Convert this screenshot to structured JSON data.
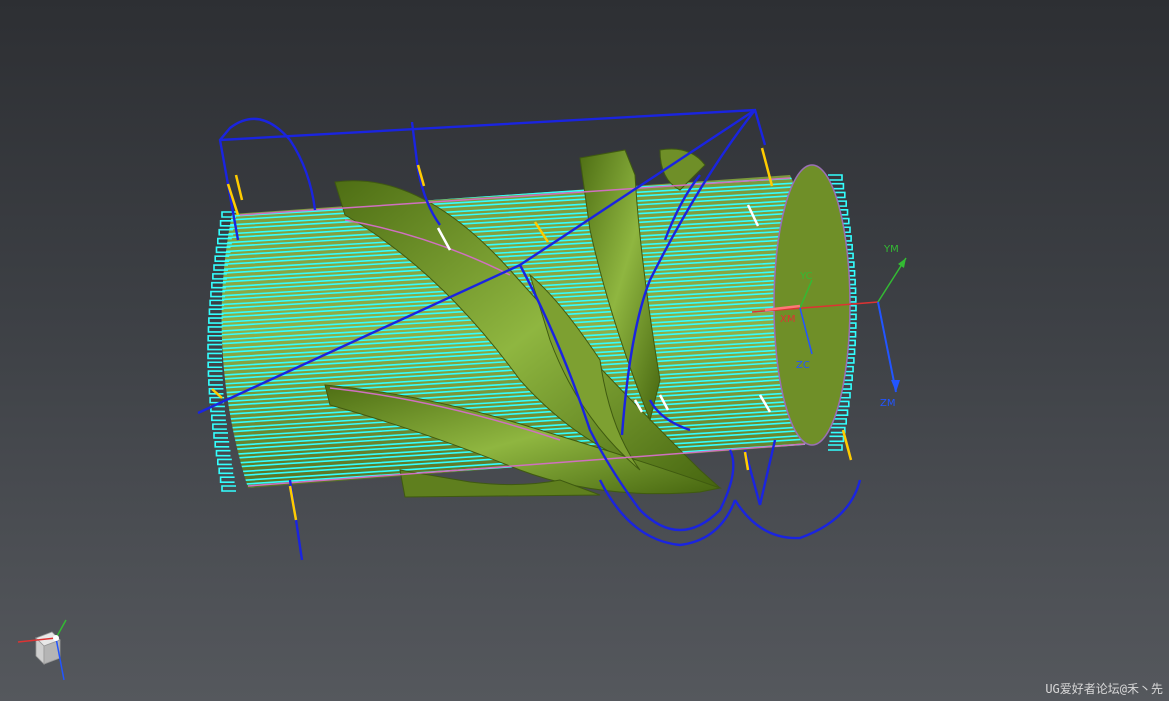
{
  "viewport": {
    "wcs_labels": {
      "x": "XM",
      "y": "YM",
      "z": "ZM"
    },
    "csys_labels": {
      "x": "XC",
      "y": "YC",
      "z": "ZC"
    },
    "watermark": "UG爱好者论坛@禾丶先"
  },
  "colors": {
    "background_top": "#2d2f33",
    "background_bottom": "#55585d",
    "part_face": "#6f8f28",
    "part_edge": "#3f5a10",
    "finish_toolpath": "#33ffff",
    "rapid_toolpath": "#1222d8",
    "engage_segment": "#ffcc00",
    "boundary": "#d070c0",
    "x_axis": "#dd3333",
    "y_axis": "#33bb33",
    "z_axis": "#2255ff"
  },
  "icons": {
    "view_triad": "view-triad-icon"
  }
}
